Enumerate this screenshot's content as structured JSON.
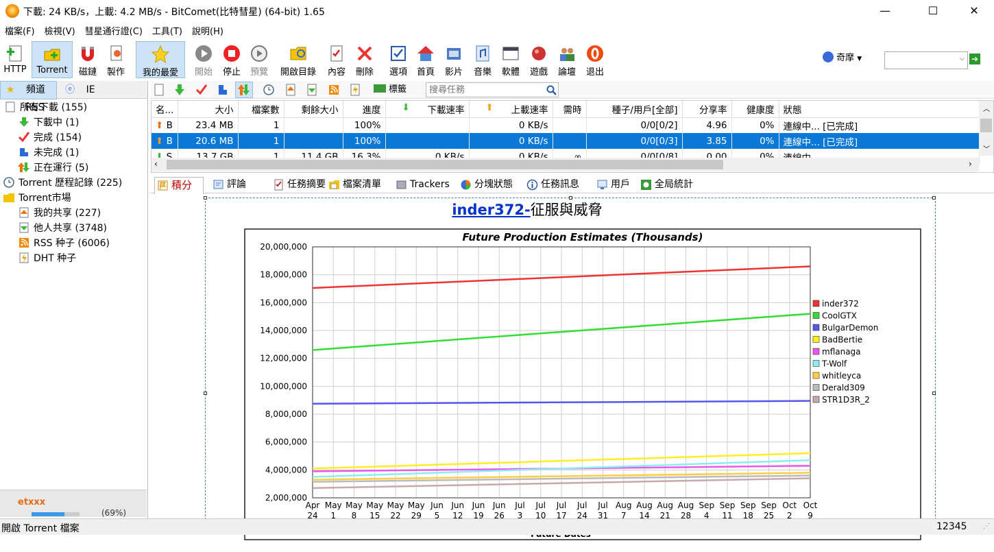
{
  "window": {
    "title": "下載: 24 KB/s，上載: 4.2 MB/s - BitComet(比特彗星) (64-bit) 1.65",
    "minimize": "—",
    "maximize": "☐",
    "close": "✕"
  },
  "menu": [
    "檔案(F)",
    "檢視(V)",
    "彗星通行證(C)",
    "工具(T)",
    "說明(H)"
  ],
  "toolbar": {
    "buttons": [
      {
        "label": "HTTP",
        "icon": "add-http-icon"
      },
      {
        "label": "Torrent",
        "icon": "add-torrent-icon"
      },
      {
        "label": "磁鏈",
        "icon": "magnet-icon"
      },
      {
        "label": "製作",
        "icon": "make-torrent-icon"
      },
      {
        "label": "我的最愛",
        "icon": "star-icon"
      },
      {
        "label": "開始",
        "icon": "play-icon"
      },
      {
        "label": "停止",
        "icon": "stop-icon"
      },
      {
        "label": "預覽",
        "icon": "preview-icon"
      },
      {
        "label": "開啟目錄",
        "icon": "open-folder-icon"
      },
      {
        "label": "內容",
        "icon": "properties-icon"
      },
      {
        "label": "刪除",
        "icon": "delete-icon"
      },
      {
        "label": "選項",
        "icon": "options-icon"
      },
      {
        "label": "首頁",
        "icon": "home-icon"
      },
      {
        "label": "影片",
        "icon": "video-icon"
      },
      {
        "label": "音樂",
        "icon": "music-icon"
      },
      {
        "label": "軟體",
        "icon": "software-icon"
      },
      {
        "label": "遊戲",
        "icon": "game-icon"
      },
      {
        "label": "論壇",
        "icon": "forum-icon"
      },
      {
        "label": "退出",
        "icon": "exit-icon"
      }
    ],
    "search_engine": "奇摩"
  },
  "left": {
    "tabs": [
      "頻道",
      "IE",
      "RSS"
    ],
    "tree": [
      {
        "label": "所有下載 (155)",
        "level": 0
      },
      {
        "label": "下載中 (1)",
        "level": 1
      },
      {
        "label": "完成 (154)",
        "level": 1
      },
      {
        "label": "未完成 (1)",
        "level": 1
      },
      {
        "label": "正在運行 (5)",
        "level": 1
      },
      {
        "label": "Torrent 歷程記錄 (225)",
        "level": 0
      },
      {
        "label": "Torrent市場",
        "level": 0
      },
      {
        "label": "我的共享 (227)",
        "level": 1
      },
      {
        "label": "他人共享 (3748)",
        "level": 1
      },
      {
        "label": "RSS 种子 (6006)",
        "level": 1
      },
      {
        "label": "DHT 种子",
        "level": 1
      }
    ],
    "user": "etxxx",
    "user_progress": "(69%)",
    "user_progress_value": 0.69
  },
  "subtoolbar": {
    "tags_label": "標籤",
    "search_placeholder": "搜尋任務"
  },
  "grid": {
    "columns": [
      "名...",
      "大小",
      "檔案數",
      "剩餘大小",
      "進度",
      "下載速率",
      "上載速率",
      "需時",
      "種子/用戶[全部]",
      "分享率",
      "健康度",
      "狀態"
    ],
    "rows": [
      [
        "B",
        "23.4 MB",
        "1",
        "",
        "100%",
        "",
        "0 KB/s",
        "",
        "0/0[0/2]",
        "4.96",
        "0%",
        "連線中... [已完成]"
      ],
      [
        "B",
        "20.6 MB",
        "1",
        "",
        "100%",
        "",
        "0 KB/s",
        "",
        "0/0[0/3]",
        "3.85",
        "0%",
        "連線中... [已完成]"
      ],
      [
        "S",
        "13.7 GB",
        "1",
        "11.4 GB",
        "16.3%",
        "0 KB/s",
        "0 KB/s",
        "∞",
        "0/0[0/8]",
        "0.00",
        "0%",
        "連線中..."
      ]
    ]
  },
  "bottom_tabs": [
    "積分",
    "評論",
    "任務摘要",
    "檔案清單",
    "Trackers",
    "分塊狀態",
    "任務訊息",
    "用戶",
    "全局統計"
  ],
  "content": {
    "link": "inder372-",
    "heading": "征服與威脅"
  },
  "statusbar": {
    "left": "開啟 Torrent 檔案",
    "right": "12345"
  },
  "chart_data": {
    "type": "line",
    "title": "Future Production Estimates (Thousands)",
    "xlabel": "Future Dates",
    "ylabel": "",
    "ylim": [
      2000000,
      20000000
    ],
    "yticks": [
      "20,000,000",
      "18,000,000",
      "16,000,000",
      "14,000,000",
      "12,000,000",
      "10,000,000",
      "8,000,000",
      "6,000,000",
      "4,000,000",
      "2,000,000"
    ],
    "categories": [
      "Apr 24",
      "May 1",
      "May 8",
      "May 15",
      "May 22",
      "May 29",
      "Jun 5",
      "Jun 12",
      "Jun 19",
      "Jun 26",
      "Jul 3",
      "Jul 10",
      "Jul 17",
      "Jul 24",
      "Jul 31",
      "Aug 7",
      "Aug 14",
      "Aug 21",
      "Aug 28",
      "Sep 4",
      "Sep 11",
      "Sep 18",
      "Sep 25",
      "Oct 2",
      "Oct 9"
    ],
    "grid": true,
    "legend_position": "right",
    "series": [
      {
        "name": "inder372",
        "color": "#ee3333",
        "start": 17050000,
        "end": 18600000
      },
      {
        "name": "CoolGTX",
        "color": "#33dd33",
        "start": 12600000,
        "end": 15200000
      },
      {
        "name": "BulgarDemon",
        "color": "#5555ee",
        "start": 8750000,
        "end": 8950000
      },
      {
        "name": "BadBertie",
        "color": "#ffee22",
        "start": 4100000,
        "end": 5200000
      },
      {
        "name": "mflanaga",
        "color": "#ee55ee",
        "start": 3900000,
        "end": 4300000
      },
      {
        "name": "T-Wolf",
        "color": "#88eeee",
        "start": 3500000,
        "end": 4700000
      },
      {
        "name": "whitleyca",
        "color": "#ffcc44",
        "start": 3300000,
        "end": 3800000
      },
      {
        "name": "Derald309",
        "color": "#bbbbbb",
        "start": 3150000,
        "end": 3600000
      },
      {
        "name": "STR1D3R_2",
        "color": "#c8a8a8",
        "start": 2700000,
        "end": 3400000
      }
    ]
  }
}
